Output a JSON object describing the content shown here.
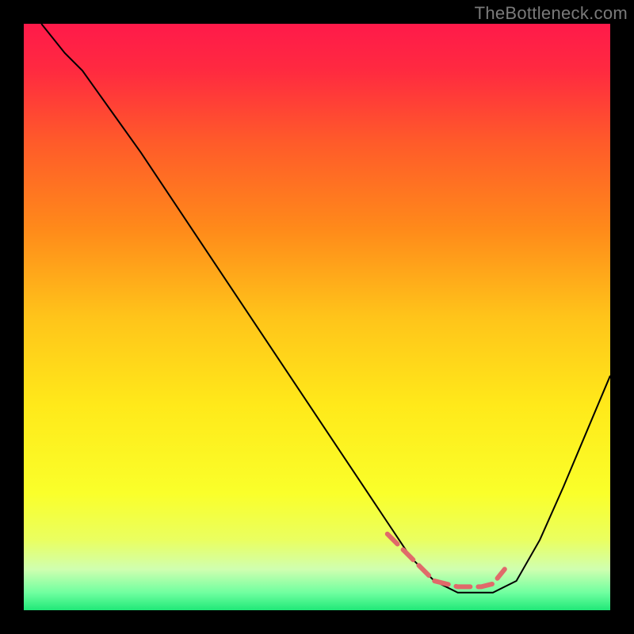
{
  "watermark": "TheBottleneck.com",
  "gradient": {
    "stops": [
      {
        "offset": 0.0,
        "color": "#ff1a4a"
      },
      {
        "offset": 0.08,
        "color": "#ff2a40"
      },
      {
        "offset": 0.2,
        "color": "#ff5a2a"
      },
      {
        "offset": 0.35,
        "color": "#ff8a1a"
      },
      {
        "offset": 0.5,
        "color": "#ffc41a"
      },
      {
        "offset": 0.65,
        "color": "#ffe91a"
      },
      {
        "offset": 0.8,
        "color": "#faff2a"
      },
      {
        "offset": 0.88,
        "color": "#eaff60"
      },
      {
        "offset": 0.93,
        "color": "#d0ffb0"
      },
      {
        "offset": 0.97,
        "color": "#70ffa0"
      },
      {
        "offset": 1.0,
        "color": "#20e878"
      }
    ]
  },
  "chart_data": {
    "type": "line",
    "title": "",
    "xlabel": "",
    "ylabel": "",
    "xlim": [
      0,
      100
    ],
    "ylim": [
      0,
      100
    ],
    "grid": false,
    "series": [
      {
        "name": "main-curve",
        "color": "#000000",
        "stroke_width": 2,
        "x": [
          3,
          7,
          10,
          15,
          20,
          25,
          30,
          35,
          40,
          45,
          50,
          55,
          58,
          62,
          66,
          70,
          74,
          78,
          80,
          84,
          88,
          92,
          96,
          100
        ],
        "y": [
          100,
          95,
          92,
          85,
          78,
          70.5,
          63,
          55.5,
          48,
          40.5,
          33,
          25.5,
          21,
          15,
          9,
          5,
          3,
          3,
          3,
          5,
          12,
          21,
          30.5,
          40
        ]
      },
      {
        "name": "trough-highlight",
        "color": "#e06a6a",
        "stroke_width": 6,
        "dash": "18 10",
        "x": [
          62,
          66,
          70,
          74,
          78,
          80,
          82
        ],
        "y": [
          13,
          9,
          5,
          4,
          4,
          4.5,
          7
        ]
      }
    ]
  }
}
